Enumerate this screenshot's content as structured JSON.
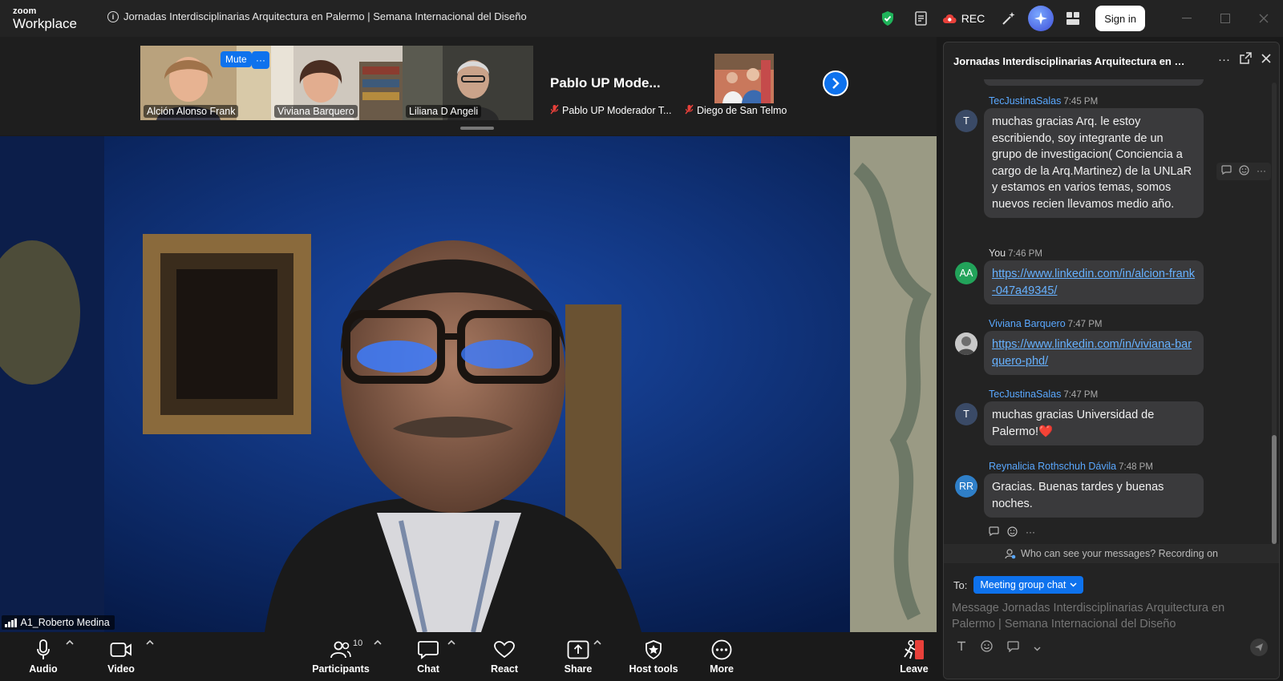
{
  "app": {
    "brand_top": "zoom",
    "brand_bottom": "Workplace",
    "meeting_title": "Jornadas Interdisciplinarias Arquitectura en Palermo | Semana Internacional del Diseño",
    "rec_label": "REC",
    "sign_in_label": "Sign in"
  },
  "strip": {
    "mute_label": "Mute",
    "more_label": "···",
    "participants": [
      {
        "name": "Alción Alonso Frank"
      },
      {
        "name": "Viviana Barquero"
      },
      {
        "name": "Liliana D Angeli"
      },
      {
        "name": "Pablo UP Moderador T...",
        "big_name": "Pablo UP Mode...",
        "muted": true
      },
      {
        "name": "Diego de San Telmo",
        "muted": true
      }
    ]
  },
  "main_video": {
    "speaker": "A1_Roberto Medina"
  },
  "toolbar": {
    "audio": "Audio",
    "video": "Video",
    "participants": "Participants",
    "participants_count": "10",
    "chat": "Chat",
    "react": "React",
    "share": "Share",
    "host_tools": "Host tools",
    "more": "More",
    "leave": "Leave"
  },
  "chat": {
    "title": "Jornadas Interdisciplinarias Arquitectura en Palermo | Semana Internacional del Diseño",
    "messages": [
      {
        "sender": "TecJustinaSalas",
        "time": "7:45 PM",
        "avatar": "T",
        "text": "muchas gracias Arq. le estoy escribiendo, soy integrante de un grupo de investigacion( Conciencia a cargo de la Arq.Martinez) de la UNLaR y estamos en varios temas, somos nuevos recien llevamos medio año."
      },
      {
        "sender": "You",
        "time": "7:46 PM",
        "avatar": "AA",
        "link": "https://www.linkedin.com/in/alcion-frank-047a49345/"
      },
      {
        "sender": "Viviana Barquero",
        "time": "7:47 PM",
        "avatar": "",
        "link": "https://www.linkedin.com/in/viviana-barquero-phd/"
      },
      {
        "sender": "TecJustinaSalas",
        "time": "7:47 PM",
        "avatar": "T",
        "text": "muchas gracias Universidad de Palermo!",
        "emoji": "❤️"
      },
      {
        "sender": "Reynalicia Rothschuh Dávila",
        "time": "7:48 PM",
        "avatar": "RR",
        "text": "Gracias. Buenas tardes y buenas noches."
      }
    ],
    "notice": "Who can see your messages? Recording on",
    "to_label": "To:",
    "recipient": "Meeting group chat",
    "placeholder": "Message Jornadas Interdisciplinarias Arquitectura en Palermo | Semana Internacional del Diseño"
  },
  "colors": {
    "accent": "#0e72ed",
    "avatar_green": "#22a35a",
    "avatar_t": "#3a4a66",
    "avatar_rr": "#2f7fc8",
    "link": "#66b1ff"
  }
}
